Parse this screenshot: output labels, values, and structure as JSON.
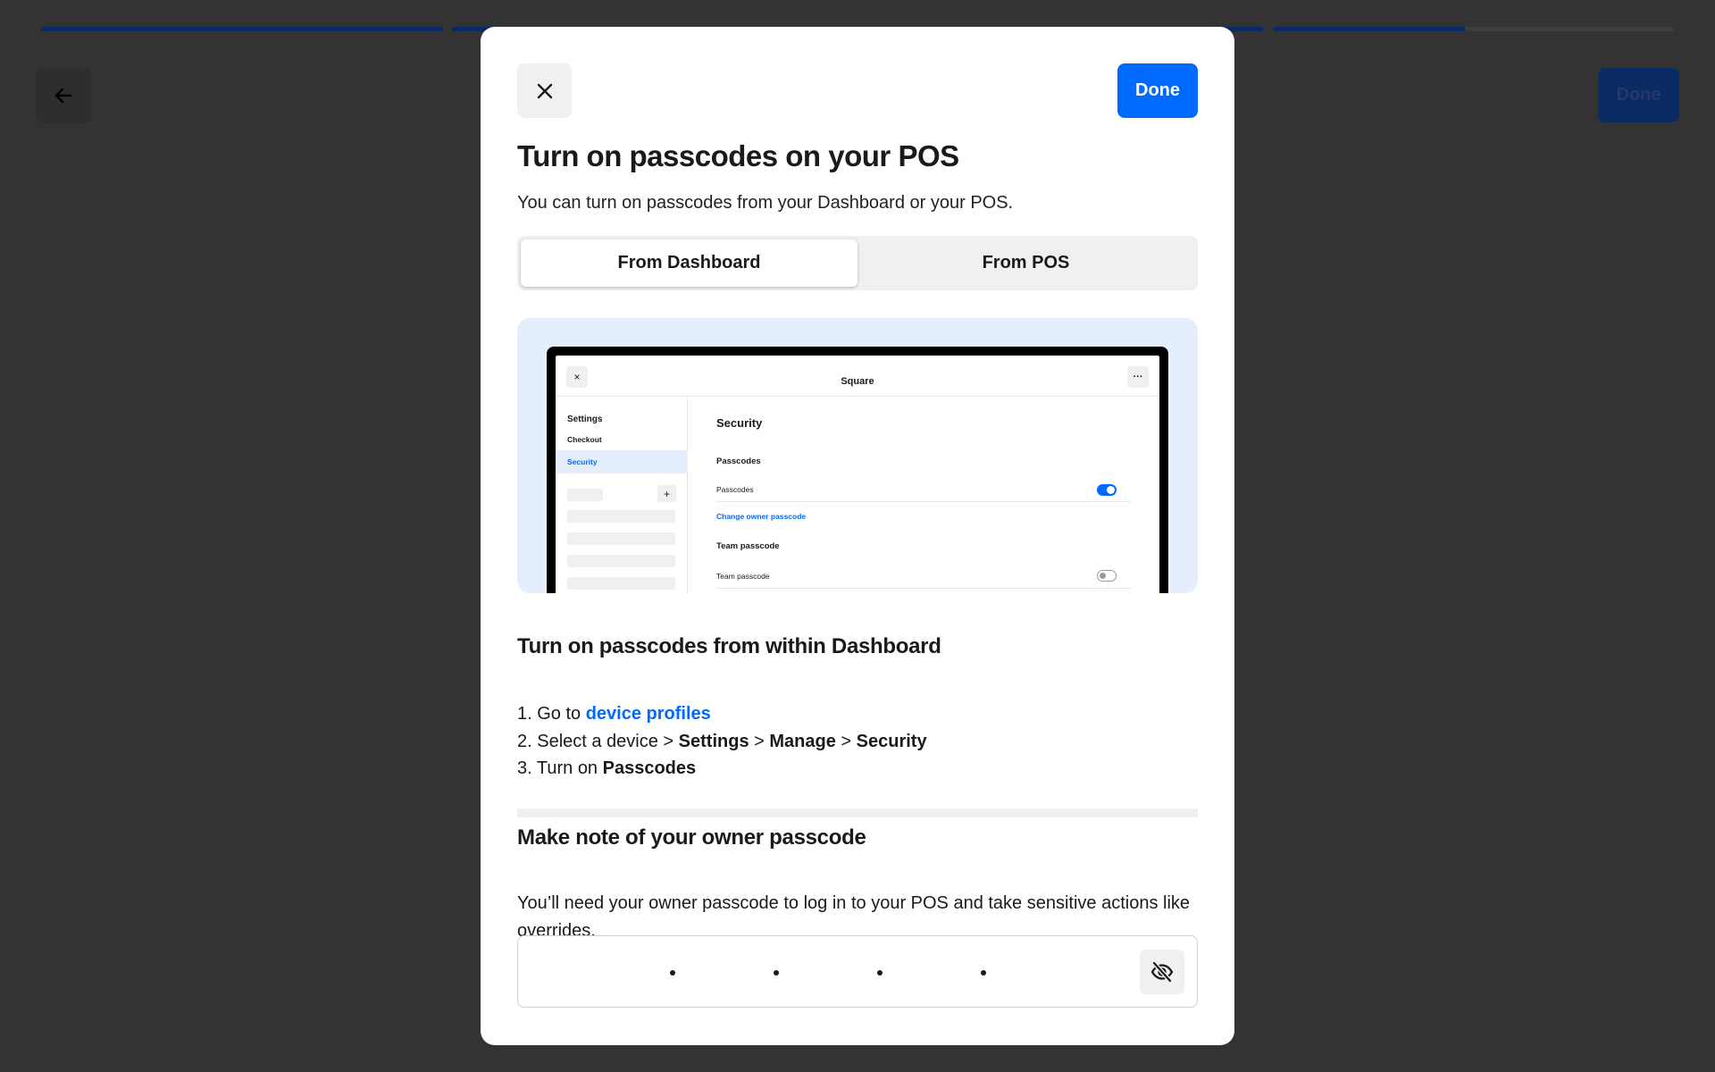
{
  "background": {
    "done_label": "Done",
    "progress": {
      "total_segments": 4,
      "completed_segments": 3,
      "current_segment_fill": 0.48
    }
  },
  "modal": {
    "done_label": "Done",
    "title": "Turn on passcodes on your POS",
    "intro": "You can turn on passcodes from your Dashboard or your POS.",
    "tabs": [
      {
        "label": "From Dashboard",
        "active": true
      },
      {
        "label": "From POS",
        "active": false
      }
    ],
    "illustration": {
      "app_title": "Square",
      "close_glyph": "×",
      "more_glyph": "···",
      "plus_glyph": "+",
      "sidebar": {
        "heading": "Settings",
        "items": [
          "Checkout",
          "Security"
        ],
        "selected": "Security"
      },
      "main": {
        "heading": "Security",
        "section1": "Passcodes",
        "row1": "Passcodes",
        "row1_on": true,
        "link": "Change owner passcode",
        "section2": "Team passcode",
        "row2": "Team passcode",
        "row2_on": false
      }
    },
    "steps_heading": "Turn on passcodes from within Dashboard",
    "steps": {
      "s1_prefix": "1. Go to ",
      "s1_link": "device profiles",
      "s2_prefix": "2. Select a device > ",
      "s2_b1": "Settings",
      "s2_sep1": " > ",
      "s2_b2": "Manage",
      "s2_sep2": " > ",
      "s2_b3": "Security",
      "s3_prefix": "3. Turn on ",
      "s3_b": "Passcodes"
    },
    "note_heading": "Make note of your owner passcode",
    "note_text": "You’ll need your owner passcode to log in to your POS and take sensitive actions like overrides.",
    "passcode": {
      "masked_digit_count": 4
    }
  },
  "icons": {
    "back": "arrow-left-icon",
    "close": "close-icon",
    "visibility": "eye-off-icon"
  },
  "colors": {
    "accent": "#006aff",
    "overlay": "#333333",
    "illustration_bg": "#e5effc"
  }
}
